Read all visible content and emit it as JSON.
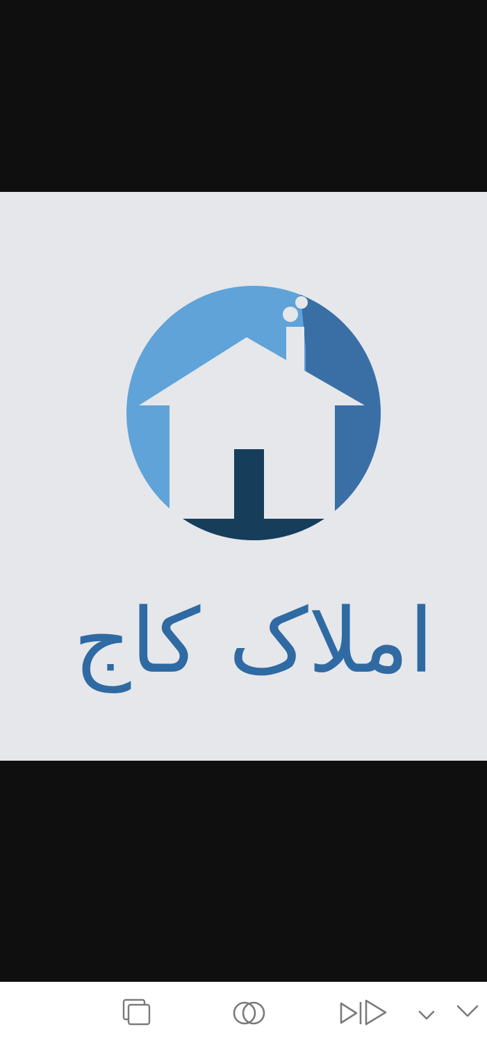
{
  "image": {
    "logo_wordmark": "املاک کاج",
    "colors": {
      "background": "#e6e7ea",
      "circle_light": "#5fa3d8",
      "circle_dark": "#3a6fa6",
      "navy": "#163e5b",
      "text_blue": "#2f6aa3"
    }
  },
  "toolbar": {
    "icons": [
      "copy-icon",
      "overlap-circles-icon",
      "play-next-icon",
      "chevron-down-small-icon",
      "chevron-down-icon"
    ]
  }
}
